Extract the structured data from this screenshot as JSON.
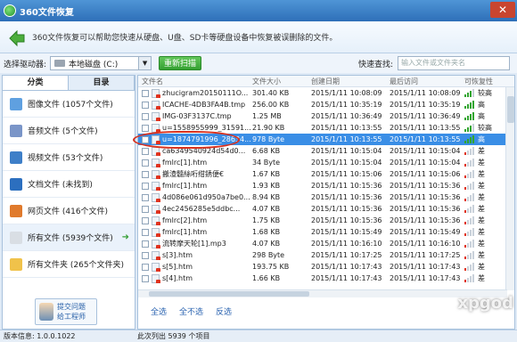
{
  "window": {
    "title": "360文件恢复",
    "close_label": "✕"
  },
  "description": "360文件恢复可以帮助您快速从硬盘、U盘、SD卡等硬盘设备中恢复被误删除的文件。",
  "toolbar": {
    "drive_label": "选择驱动器:",
    "drive_value": "本地磁盘 (C:)",
    "scan_label": "重新扫描",
    "search_label": "快速查找:",
    "search_placeholder": "输入文件或文件夹名"
  },
  "sidebar": {
    "tabs": [
      "分类",
      "目录"
    ],
    "items": [
      {
        "label": "图像文件 (1057个文件)",
        "icon": "image-icon",
        "color": "#5fa0e0"
      },
      {
        "label": "音频文件 (5个文件)",
        "icon": "music-icon",
        "color": "#7a95c8"
      },
      {
        "label": "视频文件 (53个文件)",
        "icon": "video-icon",
        "color": "#3e7fc8"
      },
      {
        "label": "文档文件 (未找到)",
        "icon": "document-icon",
        "color": "#2c6fbf"
      },
      {
        "label": "网页文件 (416个文件)",
        "icon": "webpage-icon",
        "color": "#e07a2c"
      },
      {
        "label": "所有文件 (5939个文件)",
        "icon": "file-icon",
        "color": "#d9dee4"
      },
      {
        "label": "所有文件夹 (265个文件夹)",
        "icon": "folder-icon",
        "color": "#f0c24a"
      }
    ],
    "help_line1": "提交问题",
    "help_line2": "给工程师"
  },
  "table": {
    "headers": [
      "文件名",
      "文件大小",
      "创建日期",
      "最后访问",
      "可恢复性"
    ],
    "rows": [
      {
        "name": "zhucigram20150111O...",
        "size": "301.40 KB",
        "created": "2015/1/11 10:08:09",
        "accessed": "2015/1/11 10:08:09",
        "rec": "较高",
        "level": 3
      },
      {
        "name": "ICACHE-4DB3FA4B.tmp",
        "size": "256.00 KB",
        "created": "2015/1/11 10:35:19",
        "accessed": "2015/1/11 10:35:19",
        "rec": "高",
        "level": 4
      },
      {
        "name": "IMG-03F3137C.tmp",
        "size": "1.25 MB",
        "created": "2015/1/11 10:36:49",
        "accessed": "2015/1/11 10:36:49",
        "rec": "高",
        "level": 4
      },
      {
        "name": "u=1558955999_31591...",
        "size": "21.90 KB",
        "created": "2015/1/11 10:13:55",
        "accessed": "2015/1/11 10:13:55",
        "rec": "较高",
        "level": 3
      },
      {
        "name": "u=1874791996_28634...",
        "size": "978 Byte",
        "created": "2015/1/11 10:13:55",
        "accessed": "2015/1/11 10:13:55",
        "rec": "高",
        "level": 4
      },
      {
        "name": "ca6349540924d54d0...",
        "size": "6.68 KB",
        "created": "2015/1/11 10:15:04",
        "accessed": "2015/1/11 10:15:04",
        "rec": "差",
        "level": 1
      },
      {
        "name": "fmlrc[1].htm",
        "size": "34 Byte",
        "created": "2015/1/11 10:15:04",
        "accessed": "2015/1/11 10:15:04",
        "rec": "差",
        "level": 1
      },
      {
        "name": "搬渣髓絲哘绀銹便€",
        "size": "1.67 KB",
        "created": "2015/1/11 10:15:06",
        "accessed": "2015/1/11 10:15:06",
        "rec": "差",
        "level": 1
      },
      {
        "name": "fmlrc[1].htm",
        "size": "1.93 KB",
        "created": "2015/1/11 10:15:36",
        "accessed": "2015/1/11 10:15:36",
        "rec": "差",
        "level": 1
      },
      {
        "name": "4d086e061d950a7be0...",
        "size": "8.94 KB",
        "created": "2015/1/11 10:15:36",
        "accessed": "2015/1/11 10:15:36",
        "rec": "差",
        "level": 1
      },
      {
        "name": "4ec2456285e5ddbc...",
        "size": "4.07 KB",
        "created": "2015/1/11 10:15:36",
        "accessed": "2015/1/11 10:15:36",
        "rec": "差",
        "level": 1
      },
      {
        "name": "fmlrc[2].htm",
        "size": "1.75 KB",
        "created": "2015/1/11 10:15:36",
        "accessed": "2015/1/11 10:15:36",
        "rec": "差",
        "level": 1
      },
      {
        "name": "fmlrc[1].htm",
        "size": "1.68 KB",
        "created": "2015/1/11 10:15:49",
        "accessed": "2015/1/11 10:15:49",
        "rec": "差",
        "level": 1
      },
      {
        "name": "流转摩天轮[1].mp3",
        "size": "4.07 KB",
        "created": "2015/1/11 10:16:10",
        "accessed": "2015/1/11 10:16:10",
        "rec": "差",
        "level": 1
      },
      {
        "name": "s[3].htm",
        "size": "298 Byte",
        "created": "2015/1/11 10:17:25",
        "accessed": "2015/1/11 10:17:25",
        "rec": "差",
        "level": 1
      },
      {
        "name": "s[5].htm",
        "size": "193.75 KB",
        "created": "2015/1/11 10:17:43",
        "accessed": "2015/1/11 10:17:43",
        "rec": "差",
        "level": 1
      },
      {
        "name": "s[4].htm",
        "size": "1.66 KB",
        "created": "2015/1/11 10:17:43",
        "accessed": "2015/1/11 10:17:43",
        "rec": "差",
        "level": 1
      }
    ],
    "selected_index": 4
  },
  "actions": {
    "select_all": "全选",
    "select_none": "全不选",
    "invert": "反选"
  },
  "status": {
    "version": "版本信息: 1.0.0.1022",
    "count": "此次列出 5939 个项目"
  },
  "watermark": "xpgod",
  "colors": {
    "selection": "#3a8ee6",
    "high": "#31a52f",
    "low": "#e0321d",
    "accent": "#2e6fb8"
  }
}
